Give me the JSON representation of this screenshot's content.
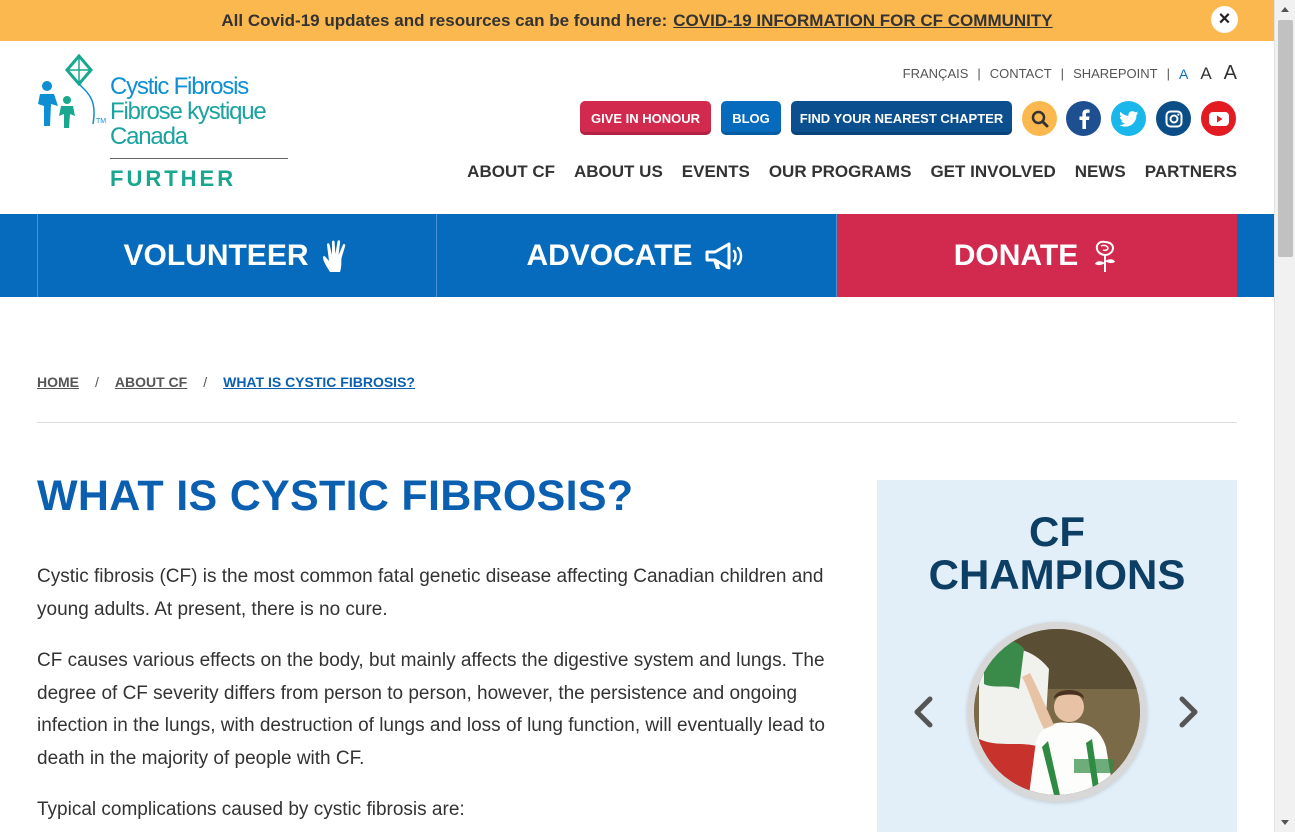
{
  "alert": {
    "text": "All Covid-19 updates and resources can be found here:",
    "link": "COVID-19 INFORMATION FOR CF COMMUNITY",
    "close": "×"
  },
  "logo": {
    "line1": "Cystic Fibrosis",
    "line2": "Fibrose kystique",
    "line3": "Canada",
    "tagline": "FURTHER",
    "tm": "TM"
  },
  "utility": {
    "francais": "FRANÇAIS",
    "contact": "CONTACT",
    "sharepoint": "SHAREPOINT",
    "fs_small": "A",
    "fs_medium": "A",
    "fs_large": "A"
  },
  "buttons": {
    "honour": "GIVE IN HONOUR",
    "blog": "BLOG",
    "chapter": "FIND YOUR NEAREST CHAPTER"
  },
  "nav": [
    "ABOUT CF",
    "ABOUT US",
    "EVENTS",
    "OUR PROGRAMS",
    "GET INVOLVED",
    "NEWS",
    "PARTNERS"
  ],
  "cta": {
    "volunteer": "VOLUNTEER",
    "advocate": "ADVOCATE",
    "donate": "DONATE"
  },
  "breadcrumb": {
    "home": "HOME",
    "about": "ABOUT CF",
    "current": "WHAT IS CYSTIC FIBROSIS?",
    "sep": "/"
  },
  "page": {
    "title": "WHAT IS CYSTIC FIBROSIS?",
    "p1": "Cystic fibrosis (CF) is the most common fatal genetic disease affecting Canadian children and young adults. At present, there is no cure.",
    "p2": "CF causes various effects on the body, but mainly affects the digestive system and lungs. The degree of CF severity differs from person to person, however, the persistence and ongoing infection in the lungs, with destruction of lungs and loss of lung function, will eventually lead to death in the majority of people with CF.",
    "p3": "Typical complications caused by cystic fibrosis are:"
  },
  "sidebar": {
    "title_line1": "CF",
    "title_line2": "CHAMPIONS"
  },
  "colors": {
    "alert": "#fbb84e",
    "blue": "#066bbd",
    "red": "#d2294e",
    "title_blue": "#0b5fb0"
  }
}
